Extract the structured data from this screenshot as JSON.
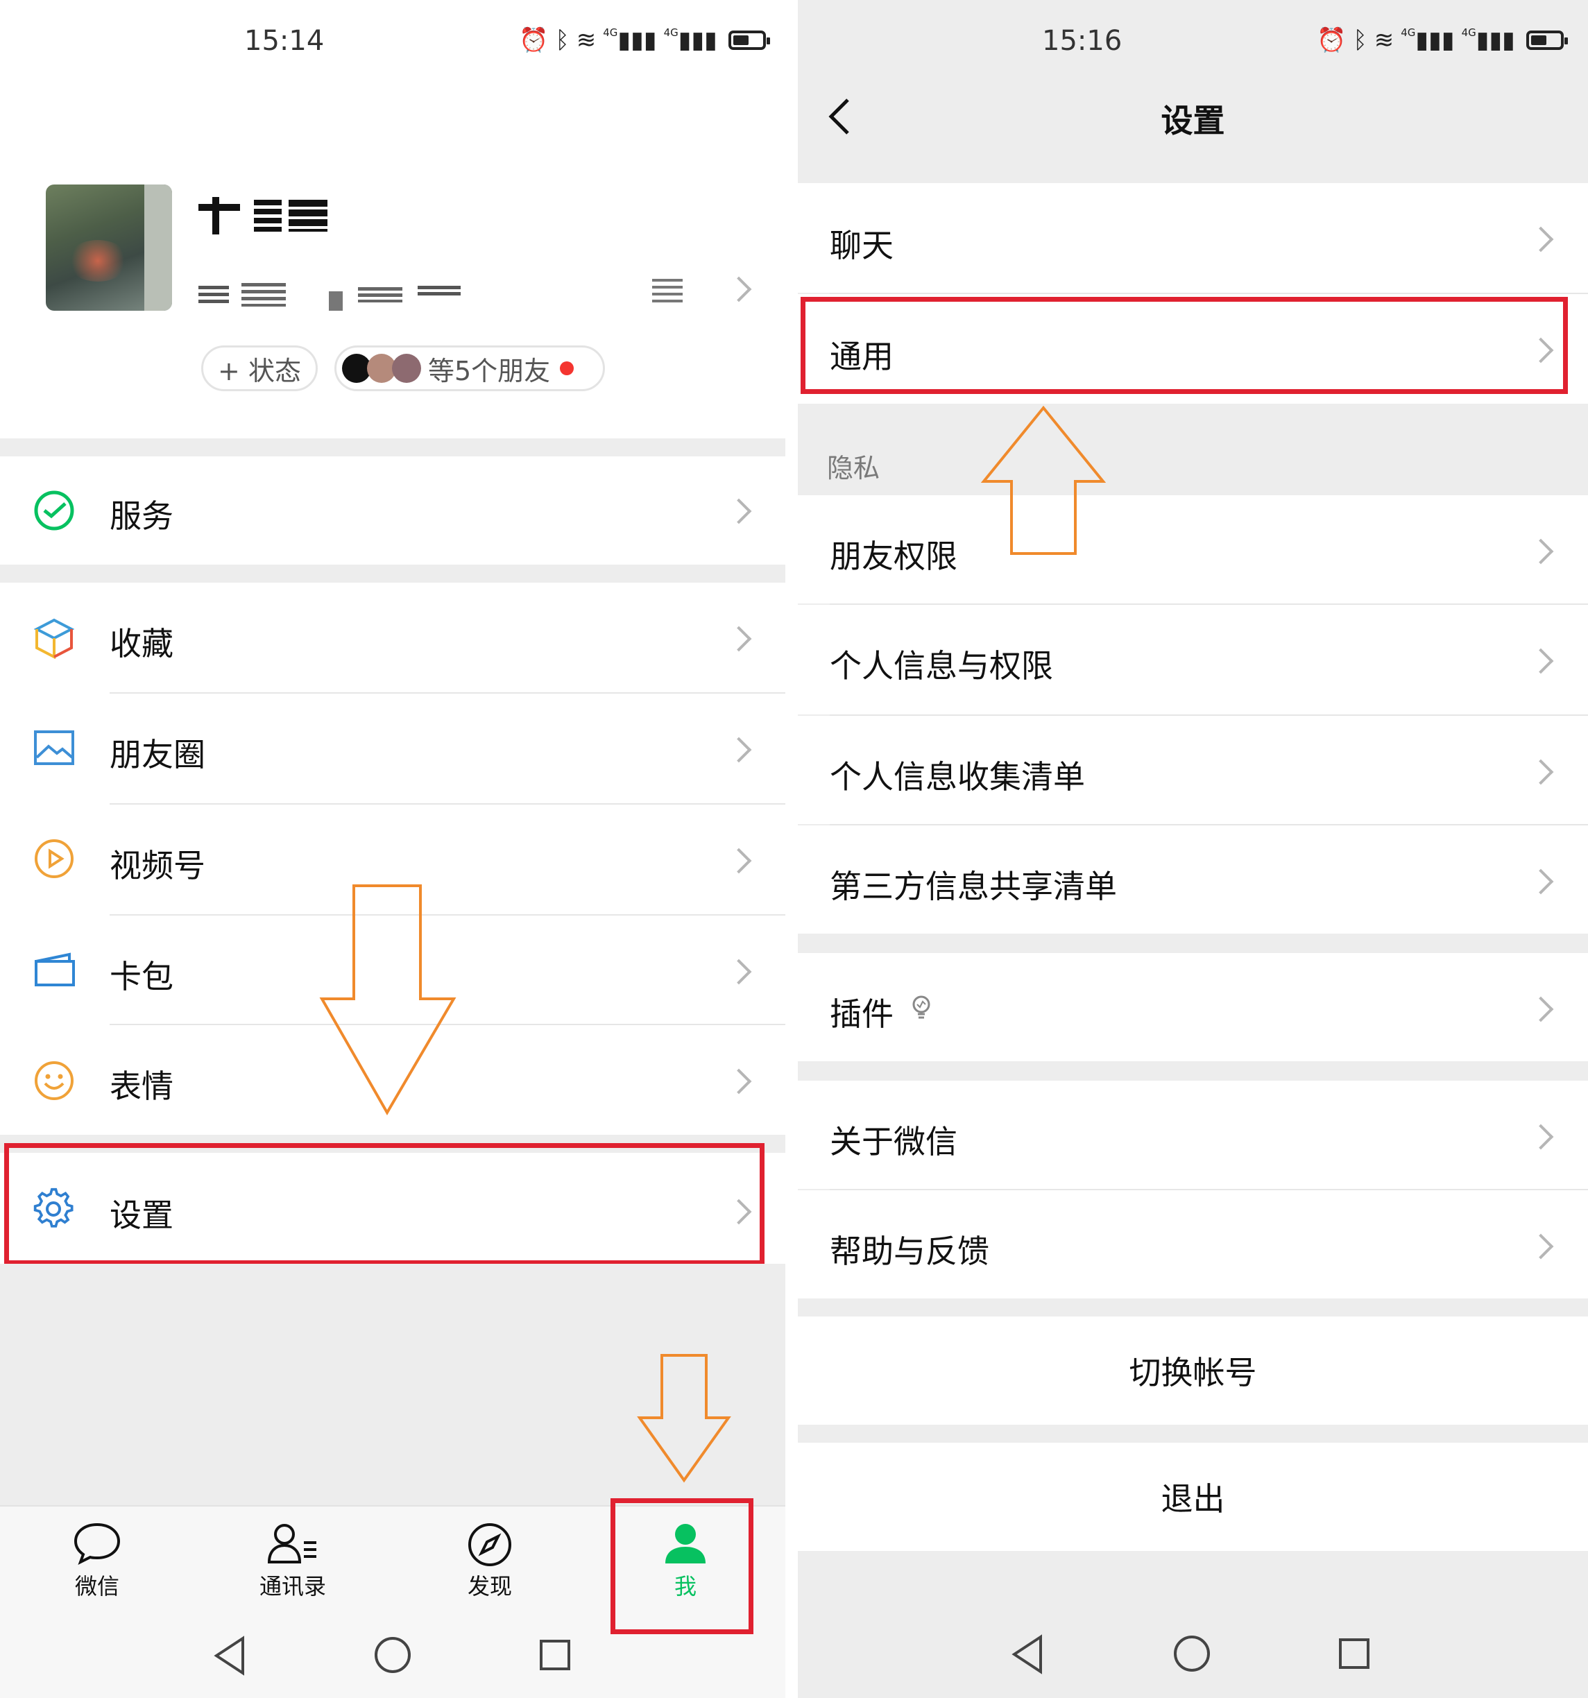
{
  "left": {
    "status_time": "15:14",
    "status_net": "4G",
    "profile": {
      "status_chip": "+ 状态",
      "friends_chip": "等5个朋友"
    },
    "menu": {
      "service": "服务",
      "favorites": "收藏",
      "moments": "朋友圈",
      "channels": "视频号",
      "cards": "卡包",
      "stickers": "表情",
      "settings": "设置"
    },
    "tabbar": [
      {
        "label": "微信",
        "icon": "chat-bubble-icon"
      },
      {
        "label": "通讯录",
        "icon": "contacts-icon"
      },
      {
        "label": "发现",
        "icon": "compass-icon"
      },
      {
        "label": "我",
        "icon": "person-icon"
      }
    ],
    "active_tab_color": "#07c160"
  },
  "right": {
    "status_time": "15:16",
    "status_net": "4G",
    "title": "设置",
    "items": {
      "chat": "聊天",
      "general": "通用",
      "privacy_header": "隐私",
      "friend_permissions": "朋友权限",
      "personal_info_permissions": "个人信息与权限",
      "personal_info_list": "个人信息收集清单",
      "third_party_list": "第三方信息共享清单",
      "plugins": "插件",
      "about": "关于微信",
      "help": "帮助与反馈",
      "switch_account": "切换帐号",
      "logout": "退出"
    }
  },
  "annotation_colors": {
    "highlight_box": "#e02130",
    "arrow": "#f08a2c"
  }
}
